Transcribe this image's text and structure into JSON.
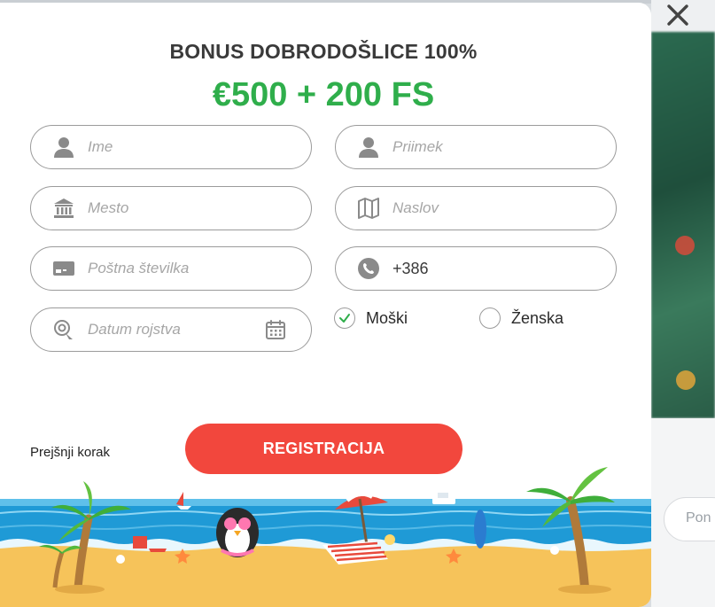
{
  "modal": {
    "title": "BONUS DOBRODOŠLICE 100%",
    "amount": "€500 + 200 FS"
  },
  "form": {
    "first_name": {
      "placeholder": "Ime",
      "icon": "user-icon"
    },
    "last_name": {
      "placeholder": "Priimek",
      "icon": "user-icon"
    },
    "city": {
      "placeholder": "Mesto",
      "icon": "bank-icon"
    },
    "address": {
      "placeholder": "Naslov",
      "icon": "map-icon"
    },
    "postal_code": {
      "placeholder": "Poštna številka",
      "icon": "card-icon"
    },
    "phone": {
      "value": "+386",
      "icon": "phone-icon"
    },
    "birth_date": {
      "placeholder": "Datum rojstva",
      "icon": "birthday-icon"
    },
    "gender": {
      "male_label": "Moški",
      "female_label": "Ženska",
      "selected": "male"
    }
  },
  "actions": {
    "previous_label": "Prejšnji korak",
    "register_label": "REGISTRACIJA"
  },
  "background": {
    "button_label": "Pon"
  },
  "colors": {
    "accent_green": "#2fae4b",
    "register_red": "#f2473d",
    "title_gray": "#3a3a3a",
    "border_gray": "#9b9b9b"
  }
}
